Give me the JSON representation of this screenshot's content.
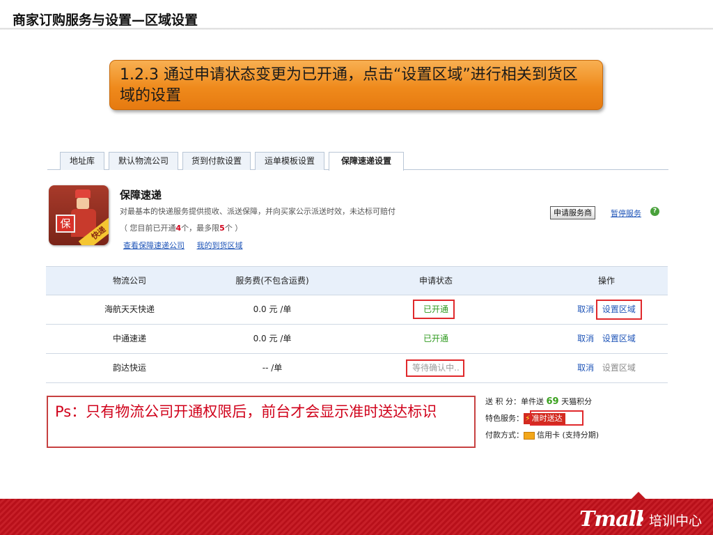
{
  "slide": {
    "title": "商家订购服务与设置—区域设置",
    "callout": "1.2.3 通过申请状态变更为已开通，点击“设置区域”进行相关到货区域的设置",
    "note": "Ps：只有物流公司开通权限后，前台才会显示准时送达标识"
  },
  "tabs": [
    {
      "label": "地址库"
    },
    {
      "label": "默认物流公司"
    },
    {
      "label": "货到付款设置"
    },
    {
      "label": "运单模板设置"
    },
    {
      "label": "保障速递设置"
    }
  ],
  "service": {
    "logo_badge": "保",
    "logo_ribbon": "快递",
    "name": "保障速递",
    "description": "对最基本的快递服务提供揽收、派送保障，并向买家公示派送时效，未达标可赔付",
    "count_prefix": "（ 您目前已开通",
    "count_open": "4",
    "count_mid": "个，最多限",
    "count_max": "5",
    "count_suffix": "个 ）",
    "link_companies": "查看保障速递公司",
    "link_regions": "我的到货区域",
    "apply_button": "申请服务商",
    "pause_link": "暂停服务",
    "help_glyph": "?"
  },
  "table": {
    "headers": {
      "company": "物流公司",
      "fee": "服务费(不包含运费)",
      "status": "申请状态",
      "action": "操作"
    },
    "rows": [
      {
        "company": "海航天天快递",
        "fee": "0.0 元 /单",
        "status": "已开通",
        "cancel": "取消",
        "set_region": "设置区域"
      },
      {
        "company": "中通速递",
        "fee": "0.0 元 /单",
        "status": "已开通",
        "cancel": "取消",
        "set_region": "设置区域"
      },
      {
        "company": "韵达快运",
        "fee": "-- /单",
        "status": "等待确认中..",
        "cancel": "取消",
        "set_region": "设置区域"
      }
    ]
  },
  "product_info": {
    "points_label": "送 积 分：",
    "points_prefix": "单件送 ",
    "points_value": "69",
    "points_suffix": " 天猫积分",
    "feature_label": "特色服务：",
    "feature_badge": "准时送达",
    "pay_label": "付款方式：",
    "pay_value": "信用卡 (支持分期)"
  },
  "footer": {
    "brand": "Tmall",
    "center": "培训中心"
  },
  "colors": {
    "callout_orange": "#ef8a1c",
    "highlight_red": "#e0282b",
    "status_green": "#2f9a1f",
    "footer_red": "#b8101a",
    "link_blue": "#1f55b8"
  }
}
